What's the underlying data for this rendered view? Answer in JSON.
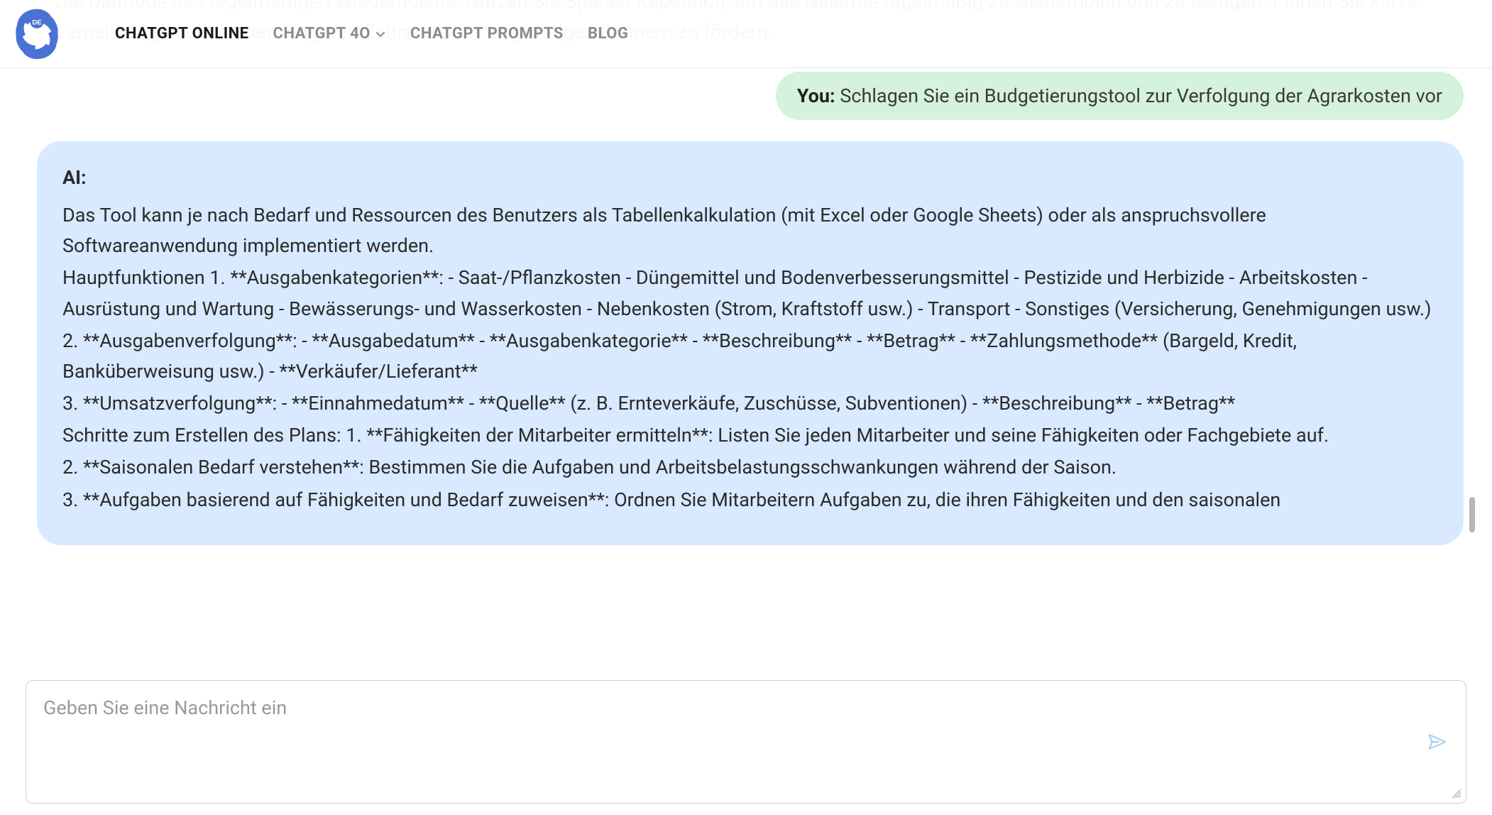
{
  "nav": {
    "items": [
      {
        "label": "CHATGPT ONLINE",
        "active": true
      },
      {
        "label": "CHATGPT 4O",
        "active": false,
        "dropdown": true
      },
      {
        "label": "CHATGPT PROMPTS",
        "active": false
      },
      {
        "label": "BLOG",
        "active": false
      }
    ]
  },
  "logo_badge": "DE",
  "faded_previous_ai": "Die Methode des regelmäßigen Wiederholens: Nutzen Sie Spaced Repetition, um das Gelernte regelmäßig zu wiederholen und zu festigen. Planen Sie kurze Lernsitzungen über einen längeren Zeitraum, um langfristiges Erinnern zu fördern.",
  "user_message": {
    "prefix": "You:",
    "text": "Schlagen Sie ein Budgetierungstool zur Verfolgung der Agrarkosten vor"
  },
  "ai_message": {
    "prefix": "AI:",
    "paragraphs": [
      "Das Tool kann je nach Bedarf und Ressourcen des Benutzers als Tabellenkalkulation (mit Excel oder Google Sheets) oder als anspruchsvollere Softwareanwendung implementiert werden.",
      "Hauptfunktionen 1. **Ausgabenkategorien**: - Saat-/Pflanzkosten - Düngemittel und Bodenverbesserungsmittel - Pestizide und Herbizide - Arbeitskosten - Ausrüstung und Wartung - Bewässerungs- und Wasserkosten - Nebenkosten (Strom, Kraftstoff usw.) - Transport - Sonstiges (Versicherung, Genehmigungen usw.)",
      "2. **Ausgabenverfolgung**: - **Ausgabedatum** - **Ausgabenkategorie** - **Beschreibung** - **Betrag** - **Zahlungsmethode** (Bargeld, Kredit, Banküberweisung usw.) - **Verkäufer/Lieferant**",
      "3. **Umsatzverfolgung**: - **Einnahmedatum** - **Quelle** (z. B. Ernteverkäufe, Zuschüsse, Subventionen) - **Beschreibung** - **Betrag**",
      "Schritte zum Erstellen des Plans: 1. **Fähigkeiten der Mitarbeiter ermitteln**: Listen Sie jeden Mitarbeiter und seine Fähigkeiten oder Fachgebiete auf.",
      "2. **Saisonalen Bedarf verstehen**: Bestimmen Sie die Aufgaben und Arbeitsbelastungsschwankungen während der Saison.",
      "3. **Aufgaben basierend auf Fähigkeiten und Bedarf zuweisen**: Ordnen Sie Mitarbeitern Aufgaben zu, die ihren Fähigkeiten und den saisonalen"
    ]
  },
  "input": {
    "placeholder": "Geben Sie eine Nachricht ein",
    "value": ""
  }
}
